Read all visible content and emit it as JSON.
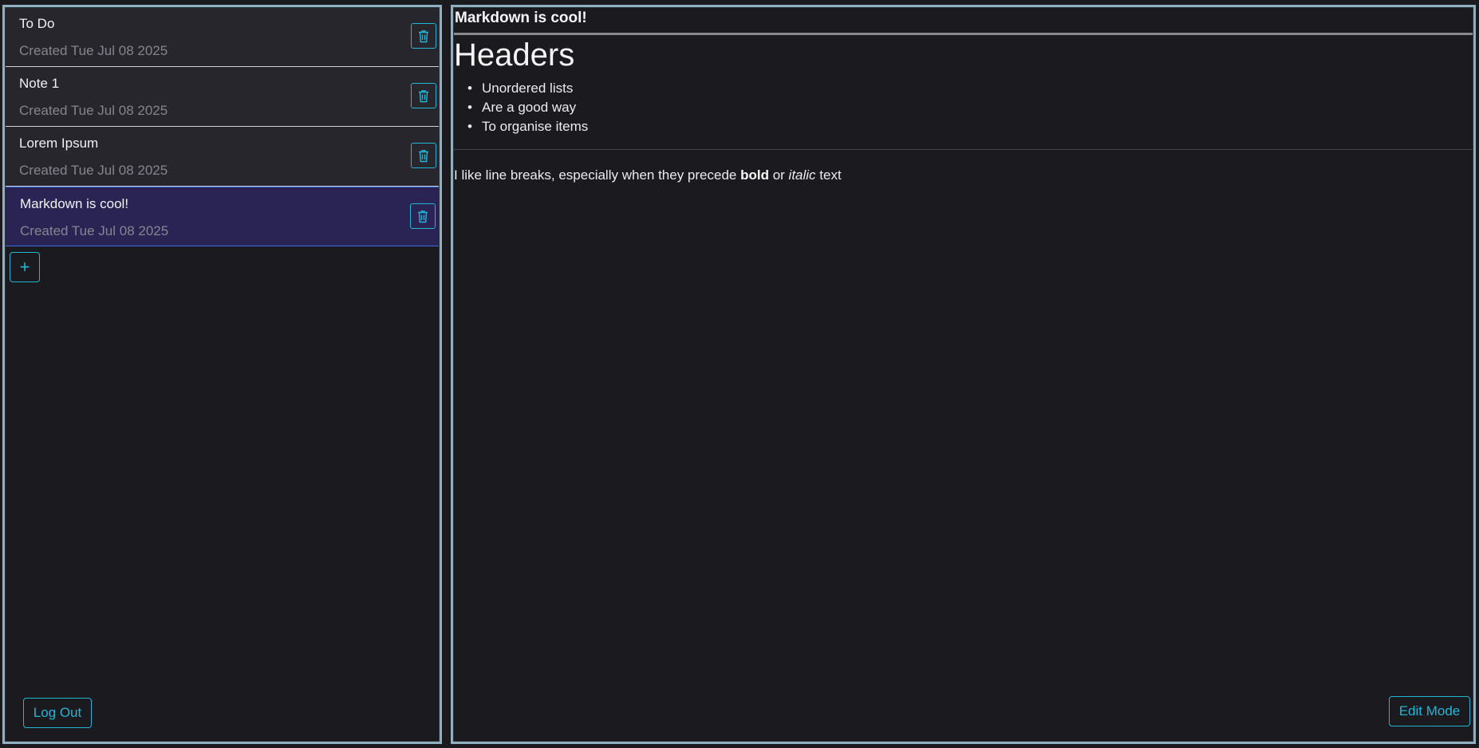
{
  "sidebar": {
    "notes": [
      {
        "title": "To Do",
        "created": "Created Tue Jul 08 2025",
        "selected": false
      },
      {
        "title": "Note 1",
        "created": "Created Tue Jul 08 2025",
        "selected": false
      },
      {
        "title": "Lorem Ipsum",
        "created": "Created Tue Jul 08 2025",
        "selected": false
      },
      {
        "title": "Markdown is cool!",
        "created": "Created Tue Jul 08 2025",
        "selected": true
      }
    ],
    "add_label": "+",
    "logout_label": "Log Out"
  },
  "main": {
    "title": "Markdown is cool!",
    "content": {
      "h1": "Headers",
      "list": [
        "Unordered lists",
        "Are a good way",
        "To organise items"
      ],
      "para_pre": "I like line breaks, especially when they precede ",
      "para_bold": "bold",
      "para_mid": " or ",
      "para_italic": "italic",
      "para_post": " text"
    },
    "edit_label": "Edit Mode"
  },
  "icons": {
    "delete": "trash-icon",
    "add": "plus-icon"
  },
  "colors": {
    "accent": "#22b5d6",
    "selected_bg": "#2a2454",
    "selected_border": "#3b6be0",
    "panel_border": "#8fb0c0",
    "background": "#1a1a1f"
  }
}
